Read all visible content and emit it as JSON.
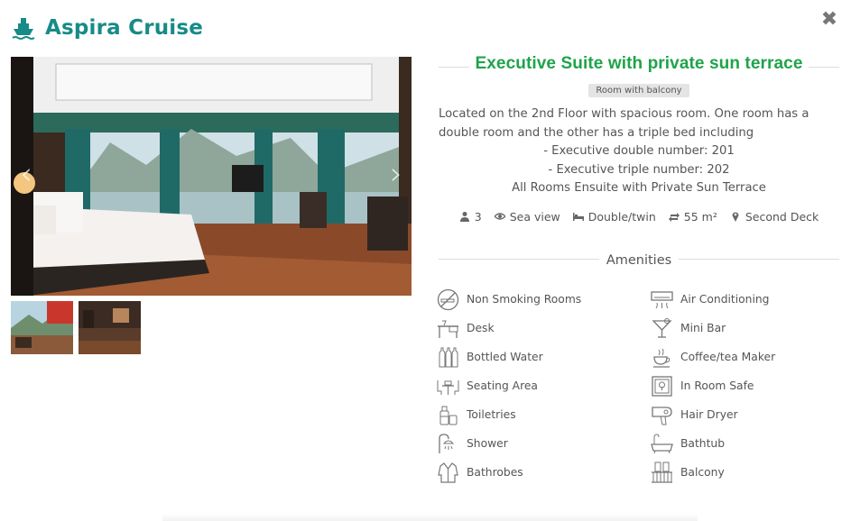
{
  "brand": {
    "name": "Aspira Cruise",
    "color": "#178b87",
    "icon": "ship-icon"
  },
  "close_icon": "close-icon",
  "gallery": {
    "prev_icon": "chevron-left-icon",
    "next_icon": "chevron-right-icon",
    "thumb_count": 2
  },
  "room": {
    "title": "Executive Suite with private sun terrace",
    "badge": "Room with balcony",
    "desc_line1": "Located on the 2nd Floor with spacious room. One room has a double room and the other has a triple bed including",
    "desc_line2": "- Executive double number: 201",
    "desc_line3": "- Executive triple number: 202",
    "desc_line4": "All Rooms Ensuite with Private Sun Terrace"
  },
  "features": [
    {
      "icon": "user-icon",
      "label": "3"
    },
    {
      "icon": "eye-icon",
      "label": "Sea view"
    },
    {
      "icon": "bed-icon",
      "label": "Double/twin"
    },
    {
      "icon": "area-icon",
      "label": "55 m²"
    },
    {
      "icon": "map-pin-icon",
      "label": "Second Deck"
    }
  ],
  "amenities_title": "Amenities",
  "amenities": [
    {
      "label": "Non Smoking Rooms",
      "icon": "no-smoking-icon"
    },
    {
      "label": "Air Conditioning",
      "icon": "air-conditioner-icon"
    },
    {
      "label": "Desk",
      "icon": "desk-icon"
    },
    {
      "label": "Mini Bar",
      "icon": "cocktail-icon"
    },
    {
      "label": "Bottled Water",
      "icon": "bottles-icon"
    },
    {
      "label": "Coffee/tea Maker",
      "icon": "coffee-cup-icon"
    },
    {
      "label": "Seating Area",
      "icon": "seating-icon"
    },
    {
      "label": "In Room Safe",
      "icon": "safe-icon"
    },
    {
      "label": "Toiletries",
      "icon": "toiletries-icon"
    },
    {
      "label": "Hair Dryer",
      "icon": "hair-dryer-icon"
    },
    {
      "label": "Shower",
      "icon": "shower-icon"
    },
    {
      "label": "Bathtub",
      "icon": "bathtub-icon"
    },
    {
      "label": "Bathrobes",
      "icon": "bathrobe-icon"
    },
    {
      "label": "Balcony",
      "icon": "balcony-icon"
    }
  ],
  "colors": {
    "accent_title": "#1fa34a",
    "badge_bg": "#e4e4e4"
  }
}
